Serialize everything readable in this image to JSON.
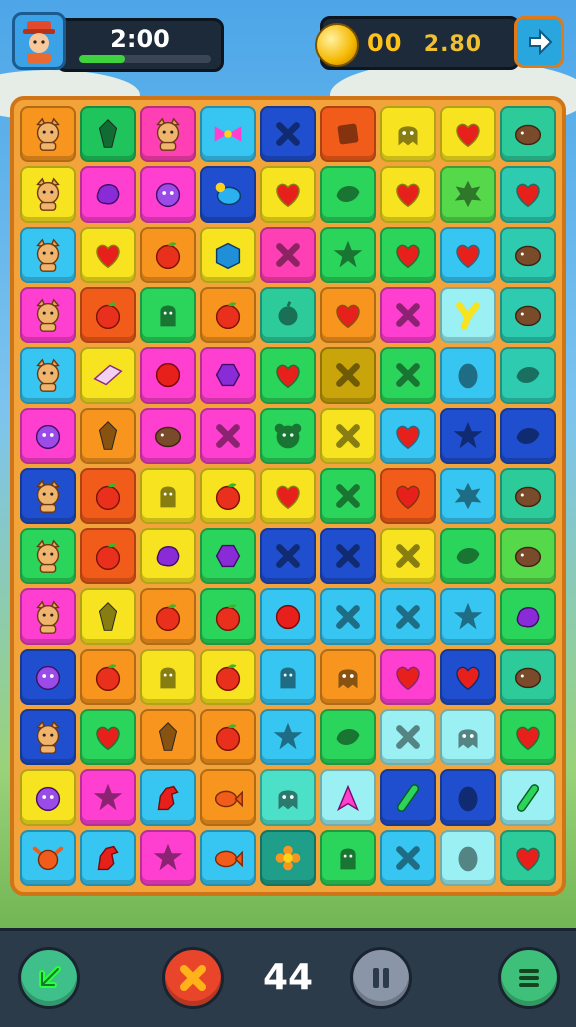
{
  "hud": {
    "timer": "2:00",
    "timer_progress": 0.35,
    "coins_digits": "00",
    "coins_value": "2.80",
    "avatar": "player-avatar-icon",
    "next_icon": "arrow-right-icon"
  },
  "board": {
    "rows": [
      [
        [
          "#f7951e",
          "cat"
        ],
        [
          "#1fc45c",
          "crystal"
        ],
        [
          "#ff3fb4",
          "cat"
        ],
        [
          "#37c6f2",
          "bow"
        ],
        [
          "#1f4fcf",
          "x"
        ],
        [
          "#f25c1a",
          "square"
        ],
        [
          "#f7e31f",
          "ghost"
        ],
        [
          "#f7e31f",
          "heart"
        ],
        [
          "#2ecb9a",
          "shell"
        ]
      ],
      [
        [
          "#f7e31f",
          "cat"
        ],
        [
          "#ff3fd0",
          "blob"
        ],
        [
          "#ff3fd0",
          "monster"
        ],
        [
          "#1f4fcf",
          "bird"
        ],
        [
          "#f7e31f",
          "heart"
        ],
        [
          "#2bd45a",
          "leaf"
        ],
        [
          "#f7e31f",
          "heart"
        ],
        [
          "#55d94b",
          "splat"
        ],
        [
          "#2ecbb0",
          "heart"
        ]
      ],
      [
        [
          "#37c6f2",
          "cat"
        ],
        [
          "#f7e31f",
          "heart"
        ],
        [
          "#f7951e",
          "apple"
        ],
        [
          "#f7e31f",
          "cube"
        ],
        [
          "#ff3fb4",
          "x"
        ],
        [
          "#2bd45a",
          "star"
        ],
        [
          "#2bd45a",
          "heart"
        ],
        [
          "#37c6f2",
          "heart"
        ],
        [
          "#2ecbb0",
          "shell"
        ]
      ],
      [
        [
          "#ff3fd0",
          "cat"
        ],
        [
          "#f25c1a",
          "apple"
        ],
        [
          "#2bd45a",
          "cactus"
        ],
        [
          "#f7951e",
          "apple"
        ],
        [
          "#2ecb9a",
          "seed"
        ],
        [
          "#f7951e",
          "heart"
        ],
        [
          "#ff3fd0",
          "x"
        ],
        [
          "#9af0f2",
          "ytile"
        ],
        [
          "#2ecbb0",
          "shell"
        ]
      ],
      [
        [
          "#37c6f2",
          "cat"
        ],
        [
          "#f7e31f",
          "eraser"
        ],
        [
          "#ff3fd0",
          "ball"
        ],
        [
          "#ff3fd0",
          "gem"
        ],
        [
          "#2bd45a",
          "heart"
        ],
        [
          "#c9a40a",
          "x"
        ],
        [
          "#2bd45a",
          "x"
        ],
        [
          "#37c6f2",
          "egg"
        ],
        [
          "#2ecbb0",
          "leaf"
        ]
      ],
      [
        [
          "#ff3fd0",
          "monster"
        ],
        [
          "#f7951e",
          "crystal"
        ],
        [
          "#ff3fd0",
          "shell"
        ],
        [
          "#ff3fd0",
          "x"
        ],
        [
          "#2bd45a",
          "bear"
        ],
        [
          "#f7e31f",
          "x"
        ],
        [
          "#37c6f2",
          "heart"
        ],
        [
          "#1f4fcf",
          "star"
        ],
        [
          "#1f4fcf",
          "leaf"
        ]
      ],
      [
        [
          "#1f4fcf",
          "cat"
        ],
        [
          "#f25c1a",
          "apple"
        ],
        [
          "#f7e31f",
          "cactus"
        ],
        [
          "#f7e31f",
          "apple"
        ],
        [
          "#f7e31f",
          "heart"
        ],
        [
          "#2bd45a",
          "x"
        ],
        [
          "#f25c1a",
          "heart"
        ],
        [
          "#37c6f2",
          "splat"
        ],
        [
          "#2ecb9a",
          "shell"
        ]
      ],
      [
        [
          "#2bd45a",
          "cat"
        ],
        [
          "#f25c1a",
          "apple"
        ],
        [
          "#f7e31f",
          "blob"
        ],
        [
          "#2bd45a",
          "gem"
        ],
        [
          "#1f4fcf",
          "x"
        ],
        [
          "#1f4fcf",
          "x"
        ],
        [
          "#f7e31f",
          "x"
        ],
        [
          "#2bd45a",
          "leaf"
        ],
        [
          "#55d94b",
          "shell"
        ]
      ],
      [
        [
          "#ff3fd0",
          "cat"
        ],
        [
          "#f7e31f",
          "crystal"
        ],
        [
          "#f7951e",
          "apple"
        ],
        [
          "#2bd45a",
          "apple"
        ],
        [
          "#37c6f2",
          "ball"
        ],
        [
          "#37c6f2",
          "x"
        ],
        [
          "#37c6f2",
          "x"
        ],
        [
          "#37c6f2",
          "star"
        ],
        [
          "#2bd45a",
          "blob"
        ]
      ],
      [
        [
          "#1f4fcf",
          "monster"
        ],
        [
          "#f7951e",
          "apple"
        ],
        [
          "#f7e31f",
          "cactus"
        ],
        [
          "#f7e31f",
          "apple"
        ],
        [
          "#37c6f2",
          "cactus"
        ],
        [
          "#f7951e",
          "ghost"
        ],
        [
          "#ff3fd0",
          "heart"
        ],
        [
          "#1f4fcf",
          "heart"
        ],
        [
          "#2ecb9a",
          "shell"
        ]
      ],
      [
        [
          "#1f4fcf",
          "cat"
        ],
        [
          "#2bd45a",
          "heart"
        ],
        [
          "#f7951e",
          "crystal"
        ],
        [
          "#f7951e",
          "apple"
        ],
        [
          "#37c6f2",
          "star"
        ],
        [
          "#2bd45a",
          "leaf"
        ],
        [
          "#9af0f2",
          "x"
        ],
        [
          "#9af0f2",
          "ghost"
        ],
        [
          "#2bd45a",
          "heart"
        ]
      ],
      [
        [
          "#f7e31f",
          "monster"
        ],
        [
          "#ff3fd0",
          "star"
        ],
        [
          "#37c6f2",
          "horse"
        ],
        [
          "#f7951e",
          "fish"
        ],
        [
          "#4de0c8",
          "ghost"
        ],
        [
          "#9af0f2",
          "arrow"
        ],
        [
          "#1f4fcf",
          "pickle"
        ],
        [
          "#1f4fcf",
          "egg"
        ],
        [
          "#9af0f2",
          "pickle"
        ]
      ],
      [
        [
          "#37c6f2",
          "ox"
        ],
        [
          "#37c6f2",
          "horse"
        ],
        [
          "#ff3fd0",
          "star"
        ],
        [
          "#37c6f2",
          "fish"
        ],
        [
          "#1f9f8a",
          "flower"
        ],
        [
          "#2bd45a",
          "cactus"
        ],
        [
          "#37c6f2",
          "x"
        ],
        [
          "#9af0f2",
          "egg"
        ],
        [
          "#2ecb9a",
          "heart"
        ]
      ]
    ]
  },
  "footer": {
    "moves": "44",
    "back_icon": "back-arrow-icon",
    "cancel_icon": "close-icon",
    "pause_icon": "pause-icon",
    "menu_icon": "menu-icon"
  }
}
